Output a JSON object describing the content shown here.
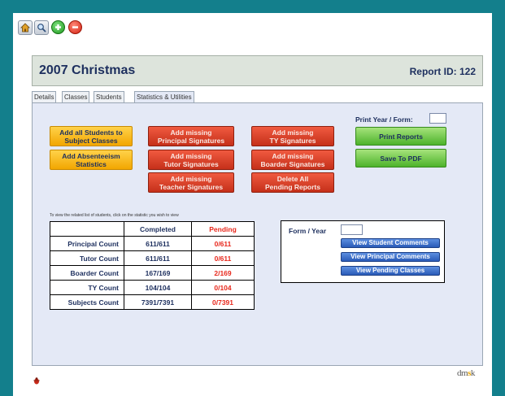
{
  "toolbar": {
    "icons": [
      "home-icon",
      "search-icon",
      "add-icon",
      "remove-icon"
    ]
  },
  "header": {
    "title": "2007 Christmas",
    "report_id": "Report ID: 122"
  },
  "tabs": [
    {
      "label": "Details"
    },
    {
      "label": "Classes"
    },
    {
      "label": "Students"
    },
    {
      "label": "Statistics & Utilities",
      "active": true
    }
  ],
  "buttons": {
    "add_all_students": [
      "Add all Students to",
      "Subject Classes"
    ],
    "add_absenteeism": [
      "Add Absenteeism",
      "Statistics"
    ],
    "missing_principal": [
      "Add missing",
      "Principal Signatures"
    ],
    "missing_tutor": [
      "Add missing",
      "Tutor Signatures"
    ],
    "missing_teacher": [
      "Add missing",
      "Teacher Signatures"
    ],
    "missing_ty": [
      "Add missing",
      "TY Signatures"
    ],
    "missing_boarder": [
      "Add missing",
      "Boarder Signatures"
    ],
    "delete_pending": [
      "Delete All",
      "Pending Reports"
    ],
    "print_reports": "Print Reports",
    "save_pdf": "Save To PDF"
  },
  "print_year": {
    "label": "Print Year / Form:",
    "value": ""
  },
  "stats": {
    "hint": "To view the related list of students, click on the statistic you wish to view",
    "headers": {
      "completed": "Completed",
      "pending": "Pending"
    },
    "rows": [
      {
        "label": "Principal Count",
        "completed": "611/611",
        "pending": "0/611"
      },
      {
        "label": "Tutor Count",
        "completed": "611/611",
        "pending": "0/611"
      },
      {
        "label": "Boarder Count",
        "completed": "167/169",
        "pending": "2/169"
      },
      {
        "label": "TY Count",
        "completed": "104/104",
        "pending": "0/104"
      },
      {
        "label": "Subjects Count",
        "completed": "7391/7391",
        "pending": "0/7391"
      }
    ]
  },
  "comments": {
    "form_year_label": "Form / Year",
    "form_year_value": "",
    "view_student": "View Student Comments",
    "view_principal": "View Principal Comments",
    "view_pending": "View Pending Classes"
  },
  "footer": {
    "brand_prefix": "dm",
    "brand_mid": "s",
    "brand_suffix": "k"
  },
  "colors": {
    "background": "#137f8c",
    "title_text": "#1d2f5e",
    "pending_text": "#e8281c"
  }
}
